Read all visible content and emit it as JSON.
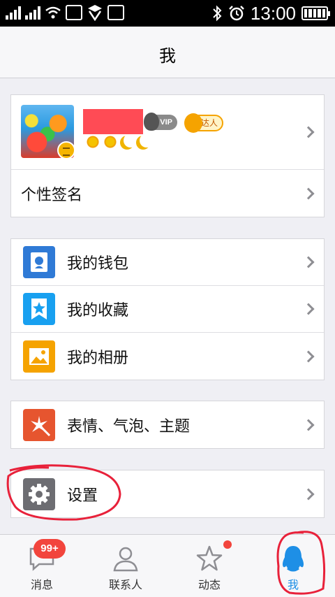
{
  "status_bar": {
    "time": "13:00"
  },
  "header": {
    "title": "我"
  },
  "profile": {
    "vip_label": "VIP",
    "daren_label": "达人"
  },
  "signature_row": {
    "label": "个性签名"
  },
  "group2": [
    {
      "label": "我的钱包",
      "icon": "wallet-icon"
    },
    {
      "label": "我的收藏",
      "icon": "favorites-icon"
    },
    {
      "label": "我的相册",
      "icon": "album-icon"
    }
  ],
  "group3": [
    {
      "label": "表情、气泡、主题",
      "icon": "emoji-theme-icon"
    }
  ],
  "group4": [
    {
      "label": "设置",
      "icon": "gear-icon"
    }
  ],
  "tabbar": {
    "tabs": [
      {
        "label": "消息",
        "badge": "99+"
      },
      {
        "label": "联系人"
      },
      {
        "label": "动态"
      },
      {
        "label": "我"
      }
    ]
  },
  "colors": {
    "accent": "#1e8fe6",
    "badge": "#f2453d",
    "annotation": "#e8213a"
  }
}
